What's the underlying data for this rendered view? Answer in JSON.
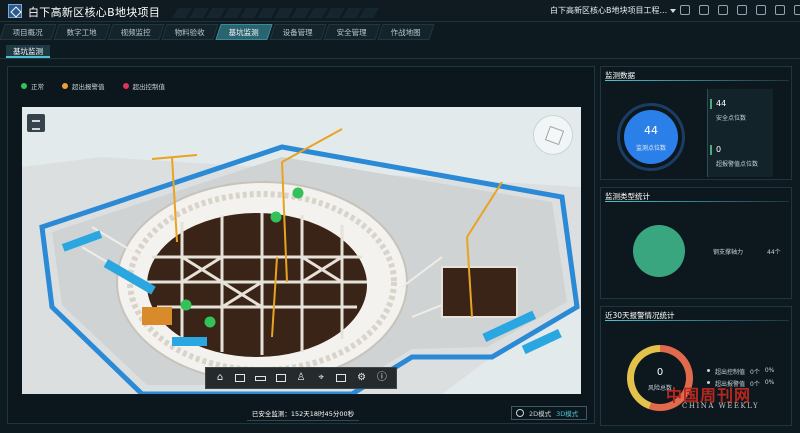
{
  "header": {
    "app_title": "白下高新区核心B地块项目",
    "project_select": "白下高新区核心B地块项目工程..."
  },
  "nav": {
    "tabs": [
      {
        "label": "项目概况",
        "active": false
      },
      {
        "label": "数字工地",
        "active": false
      },
      {
        "label": "视频监控",
        "active": false
      },
      {
        "label": "物料验收",
        "active": false
      },
      {
        "label": "基坑监测",
        "active": true
      },
      {
        "label": "设备管理",
        "active": false
      },
      {
        "label": "安全管理",
        "active": false
      },
      {
        "label": "作战地图",
        "active": false
      }
    ],
    "subtab": "基坑监测"
  },
  "legend": {
    "items": [
      {
        "label": "正常",
        "color": "#33c25a"
      },
      {
        "label": "超出报警值",
        "color": "#f0a030"
      },
      {
        "label": "超出控制值",
        "color": "#e0325a"
      }
    ]
  },
  "viewport": {
    "status_text": "已安全监测：152天18时45分00秒",
    "mode_2d": "2D模式",
    "mode_3d": "3D模式"
  },
  "toolbar": {
    "icons": [
      "home-icon",
      "frame-icon",
      "ruler-icon",
      "measure-icon",
      "person-icon",
      "location-icon",
      "report-icon",
      "settings-icon",
      "info-icon"
    ]
  },
  "monitor_data": {
    "title": "监测数据",
    "total_points": "44",
    "total_label": "监测点位数",
    "safe_points": "44",
    "safe_label": "安全点位数",
    "alarm_points": "0",
    "alarm_label": "超报警值点位数"
  },
  "monitor_types": {
    "title": "监测类型统计",
    "legend_label": "钢支撑轴力",
    "legend_value": "44个",
    "color": "#3aa67f"
  },
  "alarm_stats": {
    "title": "近30天报警情况统计",
    "total": "0",
    "total_label": "风险总数",
    "rows": [
      {
        "label": "超出控制值",
        "count": "0个",
        "percent": "0%"
      },
      {
        "label": "超出报警值",
        "count": "0个",
        "percent": "0%"
      }
    ]
  },
  "watermark": {
    "cn": "中国周刊网",
    "en": "CHINA WEEKLY"
  }
}
